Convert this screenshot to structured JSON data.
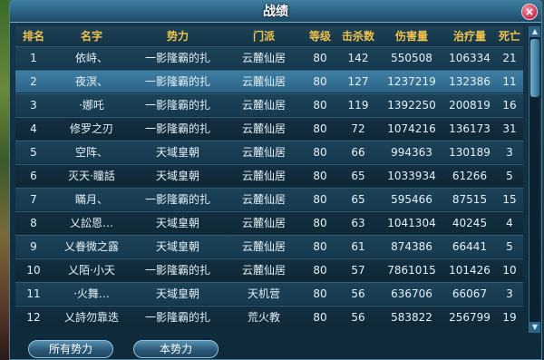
{
  "window": {
    "title": "战绩",
    "close_label": "×"
  },
  "table": {
    "columns": [
      "排名",
      "名字",
      "势力",
      "门派",
      "等级",
      "击杀数",
      "伤害量",
      "治疗量",
      "死亡"
    ],
    "selected_row": 1,
    "rows": [
      [
        "1",
        "依峙、",
        "一影隆霸的扎",
        "云麓仙居",
        "80",
        "142",
        "550508",
        "106334",
        "21"
      ],
      [
        "2",
        "夜溟、",
        "一影隆霸的扎",
        "云麓仙居",
        "80",
        "127",
        "1237219",
        "132386",
        "11"
      ],
      [
        "3",
        "·娜吒",
        "一影隆霸的扎",
        "云麓仙居",
        "80",
        "119",
        "1392250",
        "200819",
        "16"
      ],
      [
        "4",
        "修罗之刃",
        "一影隆霸的扎",
        "云麓仙居",
        "80",
        "72",
        "1074216",
        "136173",
        "31"
      ],
      [
        "5",
        "空阵、",
        "天域皇朝",
        "云麓仙居",
        "80",
        "66",
        "994363",
        "130189",
        "3"
      ],
      [
        "6",
        "灭天·瞳話",
        "天域皇朝",
        "云麓仙居",
        "80",
        "65",
        "1033934",
        "61266",
        "5"
      ],
      [
        "7",
        "瞞月、",
        "一影隆霸的扎",
        "云麓仙居",
        "80",
        "65",
        "595466",
        "87515",
        "15"
      ],
      [
        "8",
        "乂訟恩…",
        "天域皇朝",
        "云麓仙居",
        "80",
        "63",
        "1041304",
        "40245",
        "4"
      ],
      [
        "9",
        "乂眷微之露",
        "天域皇朝",
        "云麓仙居",
        "80",
        "61",
        "874386",
        "66441",
        "5"
      ],
      [
        "10",
        "乂陌·小天",
        "一影隆霸的扎",
        "云麓仙居",
        "80",
        "57",
        "7861015",
        "101426",
        "10"
      ],
      [
        "11",
        "·火舞…",
        "天域皇朝",
        "天机营",
        "80",
        "56",
        "636706",
        "66067",
        "3"
      ],
      [
        "12",
        "乂詩勿靠迭",
        "一影隆霸的扎",
        "荒火教",
        "80",
        "56",
        "583822",
        "256799",
        "19"
      ]
    ]
  },
  "buttons": {
    "all_factions": "所有势力",
    "this_faction": "本势力"
  },
  "scrollbar": {
    "up": "▲",
    "down": "▼"
  }
}
